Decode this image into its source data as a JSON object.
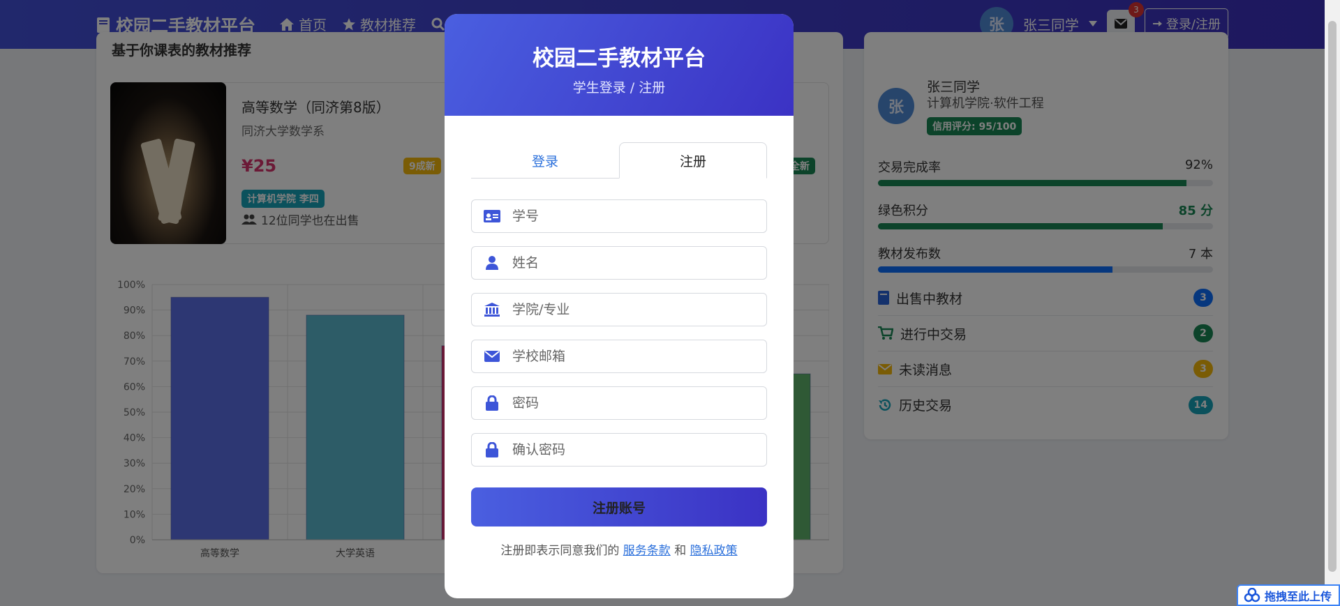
{
  "nav": {
    "brand": "校园二手教材平台",
    "links": [
      "首页",
      "教材推荐"
    ],
    "user_avatar": "张",
    "user_name": "张三同学",
    "mail_badge": "3",
    "login_label": "登录/注册"
  },
  "left": {
    "heading": "基于你课表的教材推荐",
    "book": {
      "title": "高等数学（同济第8版）",
      "author": "同济大学数学系",
      "price": "¥25",
      "condition": "9成新",
      "condition_2": "全新",
      "seller_tag": "计算机学院 李四",
      "also_selling": "12位同学也在出售"
    }
  },
  "chart_data": {
    "type": "bar",
    "categories": [
      "高等数学",
      "大学英语",
      "",
      "",
      ""
    ],
    "values": [
      95,
      88,
      76,
      null,
      65
    ],
    "ylim": [
      0,
      100
    ],
    "yticks": [
      "0%",
      "10%",
      "20%",
      "30%",
      "40%",
      "50%",
      "60%",
      "70%",
      "80%",
      "90%",
      "100%"
    ],
    "colors": [
      "#5b6ee6",
      "#5ab8cf",
      "#d6336c",
      "#ffffff",
      "#5fb36a"
    ],
    "grid": true
  },
  "right": {
    "avatar": "张",
    "name": "张三同学",
    "major": "计算机学院·软件工程",
    "credit": "信用评分: 95/100",
    "stats": [
      {
        "label": "交易完成率",
        "value": "92%",
        "fraction": 0.92,
        "color": "#198754"
      },
      {
        "label": "绿色积分",
        "value": "85 分",
        "fraction": 0.85,
        "color": "#198754"
      },
      {
        "label": "教材发布数",
        "value": "7 本",
        "fraction": 0.7,
        "color": "#0d6efd"
      }
    ],
    "list": [
      {
        "label": "出售中教材",
        "count": "3",
        "color": "#0d6efd",
        "icon": "book-icon"
      },
      {
        "label": "进行中交易",
        "count": "2",
        "color": "#198754",
        "icon": "cart-icon"
      },
      {
        "label": "未读消息",
        "count": "3",
        "color": "#f5b90a",
        "icon": "envelope-icon"
      },
      {
        "label": "历史交易",
        "count": "14",
        "color": "#17a2b8",
        "icon": "history-icon"
      }
    ]
  },
  "modal": {
    "title": "校园二手教材平台",
    "subtitle": "学生登录 / 注册",
    "tab_login": "登录",
    "tab_register": "注册",
    "fields": {
      "student_id": "学号",
      "name": "姓名",
      "college": "学院/专业",
      "email": "学校邮箱",
      "password": "密码",
      "confirm": "确认密码"
    },
    "submit": "注册账号",
    "terms_prefix": "注册即表示同意我们的",
    "terms_link": "服务条款",
    "terms_and": "和",
    "privacy_link": "隐私政策"
  },
  "drag_widget": "拖拽至此上传"
}
